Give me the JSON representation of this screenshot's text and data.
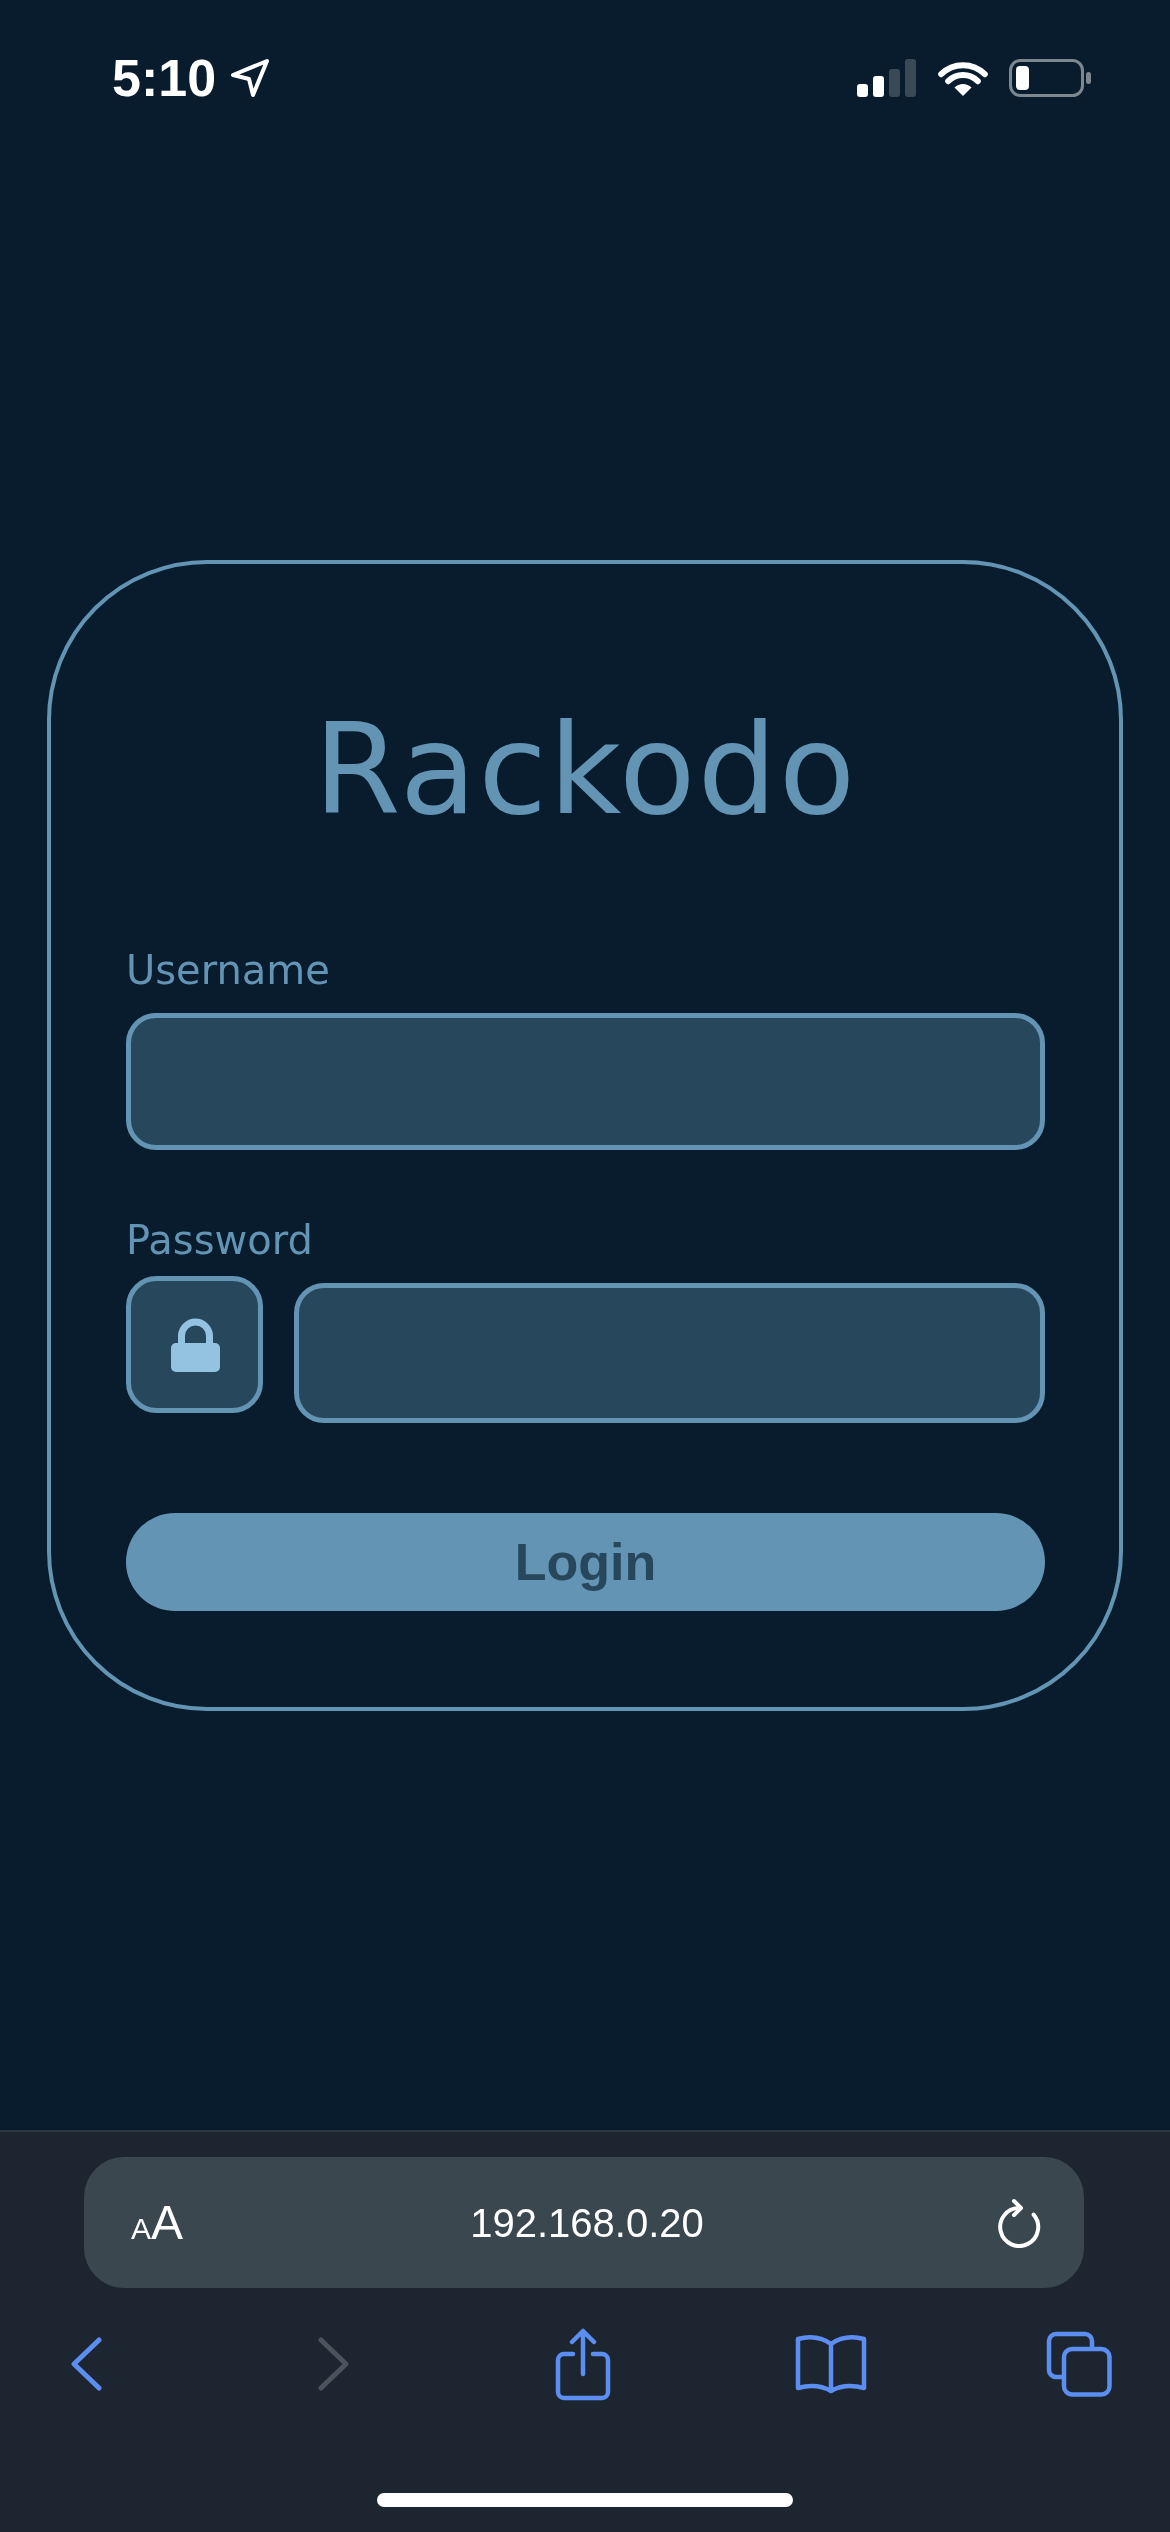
{
  "status_bar": {
    "time": "5:10"
  },
  "login_card": {
    "title": "Rackodo",
    "fields": [
      {
        "label": "Username",
        "kind": "text"
      },
      {
        "label": "Password",
        "kind": "password"
      }
    ],
    "submit_button": "Login"
  },
  "browser_bar": {
    "text_size_button": "AA",
    "url": "192.168.0.20",
    "toolbar": [
      {
        "kind": "back",
        "disabled": false
      },
      {
        "kind": "forward",
        "disabled": true
      },
      {
        "kind": "share",
        "disabled": false
      },
      {
        "kind": "bookmarks",
        "disabled": false
      },
      {
        "kind": "tabs",
        "disabled": false
      }
    ]
  }
}
